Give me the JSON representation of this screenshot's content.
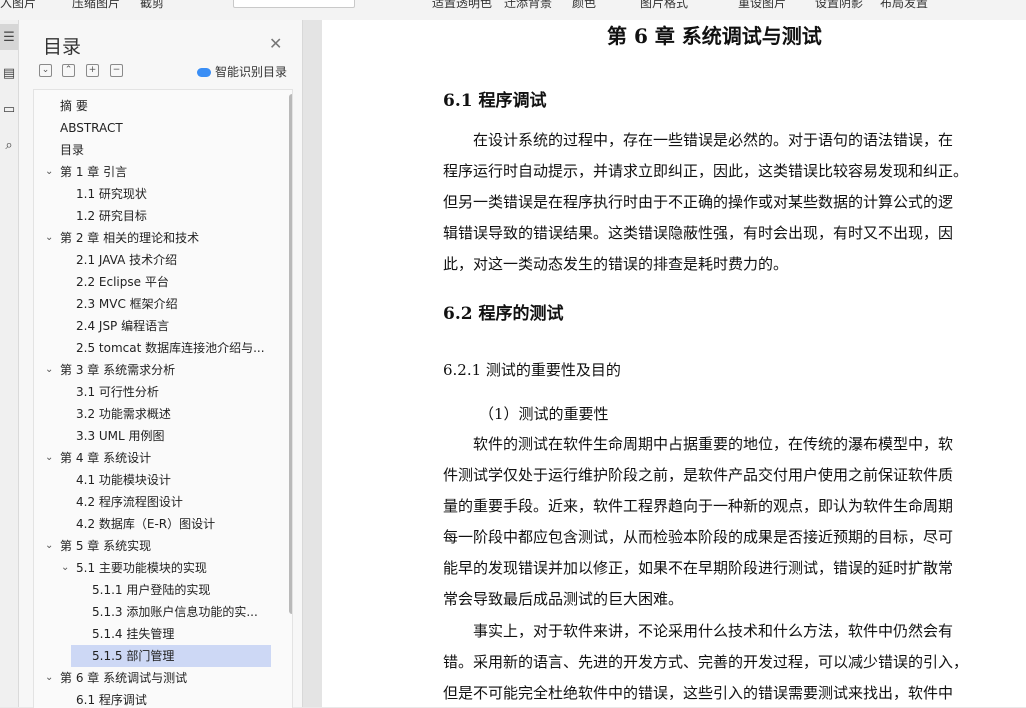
{
  "toolbar": {
    "items": [
      "入图片",
      "压缩图片",
      "截剪",
      "适置透明色",
      "迁添背景",
      "颜色",
      "图片格式",
      "重设图片",
      "设置阴影",
      "布局发置"
    ]
  },
  "rail": {
    "icons": [
      "list-icon",
      "doc-icon",
      "comment-icon",
      "find-icon"
    ]
  },
  "toc": {
    "title": "目录",
    "smart_label": "智能识别目录",
    "items": [
      {
        "text": "摘  要",
        "level": 0,
        "chev": false
      },
      {
        "text": "ABSTRACT",
        "level": 0,
        "chev": false
      },
      {
        "text": "目录",
        "level": 0,
        "chev": false
      },
      {
        "text": "第 1 章  引言",
        "level": 0,
        "chev": true
      },
      {
        "text": "1.1 研究现状",
        "level": 1,
        "chev": false
      },
      {
        "text": "1.2 研究目标",
        "level": 1,
        "chev": false
      },
      {
        "text": "第 2 章  相关的理论和技术",
        "level": 0,
        "chev": true
      },
      {
        "text": "2.1 JAVA 技术介绍",
        "level": 1,
        "chev": false
      },
      {
        "text": "2.2 Eclipse 平台",
        "level": 1,
        "chev": false
      },
      {
        "text": "2.3 MVC 框架介绍",
        "level": 1,
        "chev": false
      },
      {
        "text": "2.4 JSP 编程语言",
        "level": 1,
        "chev": false
      },
      {
        "text": "2.5 tomcat  数据库连接池介绍与...",
        "level": 1,
        "chev": false
      },
      {
        "text": "第 3 章  系统需求分析",
        "level": 0,
        "chev": true
      },
      {
        "text": "3.1  可行性分析",
        "level": 1,
        "chev": false
      },
      {
        "text": "3.2  功能需求概述",
        "level": 1,
        "chev": false
      },
      {
        "text": "3.3 UML 用例图",
        "level": 1,
        "chev": false
      },
      {
        "text": "第 4 章  系统设计",
        "level": 0,
        "chev": true
      },
      {
        "text": "4.1 功能模块设计",
        "level": 1,
        "chev": false
      },
      {
        "text": "4.2  程序流程图设计",
        "level": 1,
        "chev": false
      },
      {
        "text": "4.2  数据库（E-R）图设计",
        "level": 1,
        "chev": false
      },
      {
        "text": "第 5 章  系统实现",
        "level": 0,
        "chev": true
      },
      {
        "text": "5.1  主要功能模块的实现",
        "level": 1,
        "chev": true
      },
      {
        "text": "5.1.1  用户登陆的实现",
        "level": 2,
        "chev": false
      },
      {
        "text": "5.1.3 添加账户信息功能的实...",
        "level": 2,
        "chev": false
      },
      {
        "text": "5.1.4  挂失管理",
        "level": 2,
        "chev": false
      },
      {
        "text": "5.1.5  部门管理",
        "level": 2,
        "chev": false,
        "selected": true
      },
      {
        "text": "第 6 章  系统调试与测试",
        "level": 0,
        "chev": true
      },
      {
        "text": "6.1 程序调试",
        "level": 1,
        "chev": false
      }
    ]
  },
  "document": {
    "chapter_title": "第 6 章  系统调试与测试",
    "sec1_title": "6.1 程序调试",
    "sec1_lines": [
      "在设计系统的过程中，存在一些错误是必然的。对于语句的语法错误，在",
      "程序运行时自动提示，并请求立即纠正，因此，这类错误比较容易发现和纠正。",
      "但另一类错误是在程序执行时由于不正确的操作或对某些数据的计算公式的逻",
      "辑错误导致的错误结果。这类错误隐蔽性强，有时会出现，有时又不出现，因",
      "此，对这一类动态发生的错误的排查是耗时费力的。"
    ],
    "sec2_title": "6.2 程序的测试",
    "sub1_title": "6.2.1  测试的重要性及目的",
    "item1_title": "（1）测试的重要性",
    "para2_lines": [
      "软件的测试在软件生命周期中占据重要的地位，在传统的瀑布模型中，软",
      "件测试学仅处于运行维护阶段之前，是软件产品交付用户使用之前保证软件质",
      "量的重要手段。近来，软件工程界趋向于一种新的观点，即认为软件生命周期",
      "每一阶段中都应包含测试，从而检验本阶段的成果是否接近预期的目标，尽可",
      "能早的发现错误并加以修正，如果不在早期阶段进行测试，错误的延时扩散常",
      "常会导致最后成品测试的巨大困难。"
    ],
    "para3_lines": [
      "事实上，对于软件来讲，不论采用什么技术和什么方法，软件中仍然会有",
      "错。采用新的语言、先进的开发方式、完善的开发过程，可以减少错误的引入，",
      "但是不可能完全杜绝软件中的错误，这些引入的错误需要测试来找出，软件中"
    ]
  }
}
